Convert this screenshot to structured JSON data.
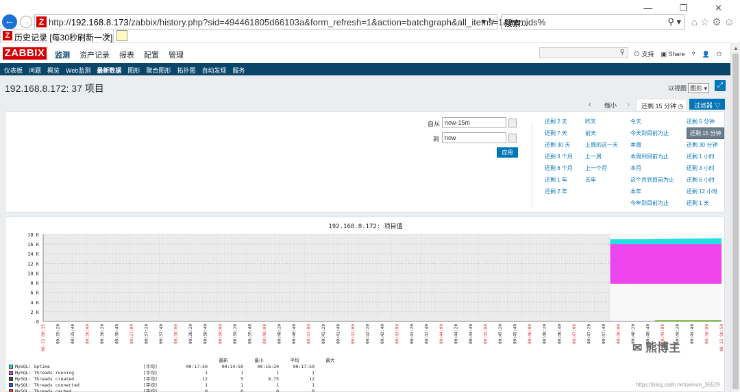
{
  "browser": {
    "url_prefix": "http://",
    "url_host": "192.168.8.173",
    "url_rest": "/zabbix/history.php?sid=494461805d66103a&form_refresh=1&action=batchgraph&all_items=1&itemids%",
    "url_controls": "▾ ↻",
    "search_placeholder": "搜索...",
    "search_icon": "⚲ ▾",
    "window_controls": "— ❐ ✕",
    "toolbar_icons": "⌂☆⚙☺",
    "tab_title": "历史记录 [每30秒刷新一次]",
    "tab_close": "✕",
    "back_icon": "←",
    "forward_icon": "→"
  },
  "zabbix": {
    "logo": "ZABBIX",
    "main_menu": [
      "监测",
      "资产记录",
      "报表",
      "配置",
      "管理"
    ],
    "header_right": [
      "⊙ 支持",
      "▣ Share",
      "?",
      "👤",
      "⏻"
    ],
    "sub_menu": [
      "仪表板",
      "问题",
      "概览",
      "Web监测",
      "最新数据",
      "图形",
      "聚合图形",
      "拓扑图",
      "自动发现",
      "服务"
    ],
    "sub_menu_selected": 4
  },
  "page": {
    "title": "192.168.8.172: 37 项目",
    "view_as_label": "以视图",
    "view_as_value": "图形 ▾",
    "fullscreen_icon": "⤢",
    "time_prev": "‹",
    "time_zoom": "缩小",
    "time_next": "›",
    "time_current": "还剩 15 分钟",
    "time_clock_icon": "◷",
    "filter_label": "过滤器 ▽"
  },
  "filter": {
    "from_label": "自从",
    "from_value": "now-15m",
    "to_label": "到",
    "to_value": "now",
    "apply_label": "应用",
    "quick": [
      [
        "还剩 2 天",
        "还剩 7 天",
        "还剩 30 天",
        "还剩 3 个月",
        "还剩 6 个月",
        "还剩 1 年",
        "还剩 2 年"
      ],
      [
        "昨天",
        "前天",
        "上周的这一天",
        "上一周",
        "上一个月",
        "去年"
      ],
      [
        "今天",
        "今天到目前为止",
        "本周",
        "本周到目前为止",
        "本月",
        "这个月到目前为止",
        "本年",
        "今年到目前为止"
      ],
      [
        "还剩 5 分钟",
        "还剩 15 分钟",
        "还剩 30 分钟",
        "还剩 1 小时",
        "还剩 3 小时",
        "还剩 6 小时",
        "还剩 12 小时",
        "还剩 1 天"
      ]
    ],
    "quick_selected": "还剩 15 分钟"
  },
  "chart_data": {
    "type": "area",
    "title": "192.168.8.172: 项目值",
    "ylim": [
      0,
      18000
    ],
    "y_ticks": [
      "0",
      "2 K",
      "4 K",
      "6 K",
      "8 K",
      "10 K",
      "12 K",
      "14 K",
      "16 K",
      "18 K"
    ],
    "x_ticks": [
      "08-15 00:35",
      "00:35:20",
      "00:35:40",
      "00:36:00",
      "00:36:20",
      "00:36:40",
      "00:37:00",
      "00:37:20",
      "00:37:40",
      "00:38:00",
      "00:38:20",
      "00:38:40",
      "00:39:00",
      "00:39:20",
      "00:39:40",
      "00:40:00",
      "00:40:20",
      "00:40:40",
      "00:41:00",
      "00:41:20",
      "00:41:40",
      "00:42:00",
      "00:42:20",
      "00:42:40",
      "00:43:00",
      "00:43:20",
      "00:43:40",
      "00:44:00",
      "00:44:20",
      "00:44:40",
      "00:45:00",
      "00:45:20",
      "00:45:40",
      "00:46:00",
      "00:46:20",
      "00:46:40",
      "00:47:00",
      "00:47:20",
      "00:47:40",
      "00:48:00",
      "00:48:20",
      "00:48:40",
      "00:49:00",
      "00:49:20",
      "00:49:40",
      "00:50:00",
      "08-15 00:50"
    ],
    "data_start_fraction": 0.836,
    "series": [
      {
        "name": "MySQL: Uptime",
        "color": "#1fe0e0",
        "values": [
          17000,
          17000,
          17100,
          17200
        ],
        "bottom": [
          16000,
          16000,
          16000,
          16000
        ]
      },
      {
        "name": "MySQL: Threads running",
        "color": "#ee44ee",
        "values": [
          16000,
          16000,
          16000,
          16000
        ],
        "bottom": [
          7800,
          7800,
          7800,
          7800
        ]
      },
      {
        "name": "MySQL: Threads connected",
        "color": "#88cc44",
        "values": [
          12,
          12,
          12,
          12
        ],
        "bottom": [
          0,
          0,
          0,
          0
        ]
      }
    ]
  },
  "legend": {
    "headers": [
      "最新",
      "最小",
      "平均",
      "最大"
    ],
    "rows": [
      {
        "name": "MySQL: Uptime",
        "fn": "[平均]",
        "vals": [
          "00:17:50",
          "00:14:50",
          "00:16:20",
          "00:17:50"
        ],
        "color": "#1fe0e0"
      },
      {
        "name": "MySQL: Threads running",
        "fn": "[平均]",
        "vals": [
          "1",
          "1",
          "1",
          "1"
        ],
        "color": "#ee44ee"
      },
      {
        "name": "MySQL: Threads created",
        "fn": "[平均]",
        "vals": [
          "12",
          "5",
          "8.75",
          "12"
        ],
        "color": "#444444"
      },
      {
        "name": "MySQL: Threads connected",
        "fn": "[平均]",
        "vals": [
          "1",
          "1",
          "1",
          "1"
        ],
        "color": "#3355ee"
      },
      {
        "name": "MySQL: Threads cached",
        "fn": "[平均]",
        "vals": [
          "0",
          "0",
          "0",
          "0"
        ],
        "color": "#ee3333"
      }
    ]
  },
  "watermark": {
    "text": "熊博主",
    "url": "https://blog.csdn.net/weixin_36529"
  }
}
